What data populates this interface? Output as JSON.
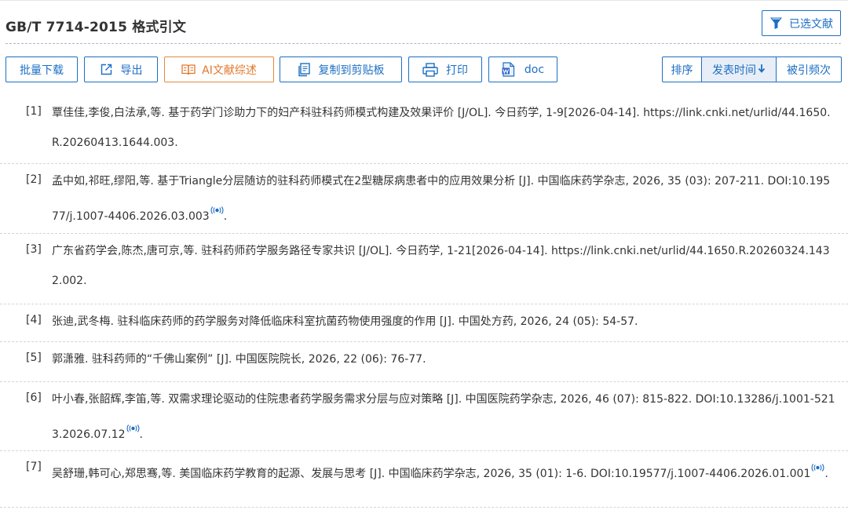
{
  "header": {
    "title": "GB/T 7714-2015 格式引文",
    "selected_button": "已选文献"
  },
  "toolbar": {
    "batch_download": "批量下载",
    "export": "导出",
    "ai_review": "AI文献综述",
    "copy": "复制到剪贴板",
    "print": "打印",
    "doc": "doc"
  },
  "sort": {
    "label": "排序",
    "by_date": "发表时间",
    "by_citation": "被引频次"
  },
  "colors": {
    "primary": "#1d6fc4",
    "accent_orange": "#e2762a"
  },
  "references": [
    {
      "num": "[1]",
      "text": "覃佳佳,李俊,白法承,等. 基于药学门诊助力下的妇产科驻科药师模式构建及效果评价 [J/OL]. 今日药学, 1-9[2026-04-14]. https://link.cnki.net/urlid/44.1650.R.20260413.1644.003.",
      "has_doi_icon": false
    },
    {
      "num": "[2]",
      "text": "孟中如,祁旺,缪阳,等. 基于Triangle分层随访的驻科药师模式在2型糖尿病患者中的应用效果分析 [J]. 中国临床药学杂志, 2026, 35 (03): 207-211. DOI:10.19577/j.1007-4406.2026.03.003",
      "has_doi_icon": true,
      "tail": "."
    },
    {
      "num": "[3]",
      "text": "广东省药学会,陈杰,唐可京,等. 驻科药师药学服务路径专家共识 [J/OL]. 今日药学, 1-21[2026-04-14]. https://link.cnki.net/urlid/44.1650.R.20260324.1432.002.",
      "has_doi_icon": false
    },
    {
      "num": "[4]",
      "text": "张迪,武冬梅. 驻科临床药师的药学服务对降低临床科室抗菌药物使用强度的作用 [J]. 中国处方药, 2026, 24 (05): 54-57.",
      "has_doi_icon": false
    },
    {
      "num": "[5]",
      "text": "郭潇雅. 驻科药师的“千佛山案例” [J]. 中国医院院长, 2026, 22 (06): 76-77.",
      "has_doi_icon": false
    },
    {
      "num": "[6]",
      "text": "叶小春,张韶辉,李笛,等. 双需求理论驱动的住院患者药学服务需求分层与应对策略 [J]. 中国医院药学杂志, 2026, 46 (07): 815-822. DOI:10.13286/j.1001-5213.2026.07.12",
      "has_doi_icon": true,
      "tail": "."
    },
    {
      "num": "[7]",
      "text": "吴舒珊,韩可心,郑思骞,等. 美国临床药学教育的起源、发展与思考 [J]. 中国临床药学杂志, 2026, 35 (01): 1-6. DOI:10.19577/j.1007-4406.2026.01.001",
      "has_doi_icon": true,
      "tail": "."
    }
  ]
}
